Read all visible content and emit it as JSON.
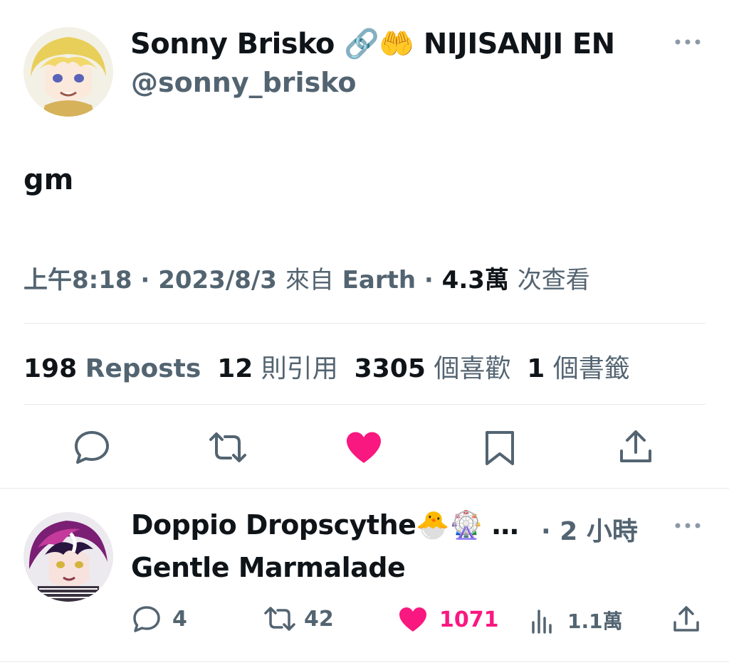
{
  "tweet": {
    "author_name": "Sonny Brisko",
    "author_emojis": "🔗🤲",
    "author_suffix": "NIJISANJI EN",
    "handle": "@sonny_brisko",
    "body": "gm",
    "time": "上午8:18",
    "sep1": "·",
    "date": "2023/8/3",
    "from_label": "來自",
    "source": "Earth",
    "sep2": "·",
    "views_count": "4.3萬",
    "views_label": "次查看"
  },
  "stats": {
    "reposts_count": "198",
    "reposts_label": "Reposts",
    "quotes_count": "12",
    "quotes_label": "則引用",
    "likes_count": "3305",
    "likes_label": "個喜歡",
    "bookmarks_count": "1",
    "bookmarks_label": "個書籤"
  },
  "actions": {
    "icons": [
      "reply-icon",
      "repost-icon",
      "like-icon",
      "bookmark-icon",
      "share-icon"
    ],
    "liked": true
  },
  "reply": {
    "author_name": "Doppio Dropscythe",
    "author_emojis": "🐣🎡",
    "ellipsis": "…",
    "sep": "·",
    "time": "2 小時",
    "body": "Gentle Marmalade",
    "reply_count": "4",
    "repost_count": "42",
    "like_count": "1071",
    "views_count": "1.1萬"
  },
  "colors": {
    "text": "#0f1419",
    "secondary": "#536471",
    "like_pink": "#f91880",
    "divider": "#e6e9eb"
  }
}
